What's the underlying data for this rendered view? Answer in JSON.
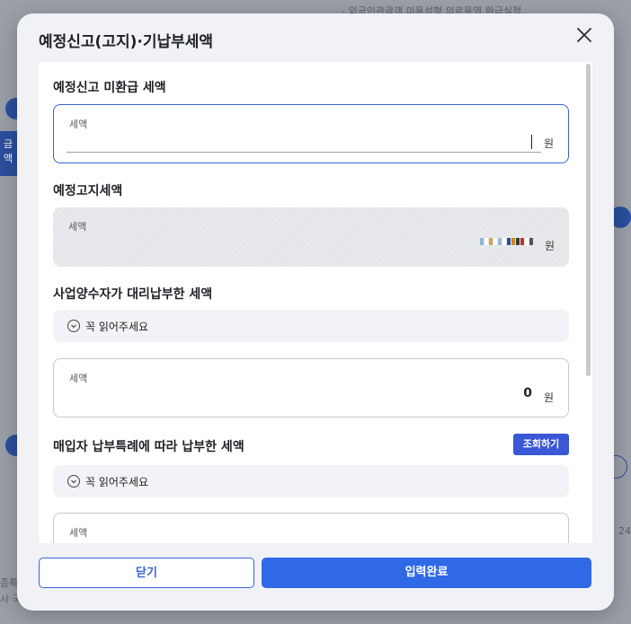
{
  "background": {
    "top_text": "- 외국인관광객 미용성형 의료용역 환급실적...",
    "side_tab": "금액",
    "bottom_left_1": "종특",
    "bottom_left_2": "사 국",
    "bottom_right": "24"
  },
  "modal": {
    "title": "예정신고(고지)·기납부세액",
    "close_icon": "close-icon",
    "sections": [
      {
        "title": "예정신고 미환급 세액",
        "field_label": "세액",
        "value": "",
        "unit": "원"
      },
      {
        "title": "예정고지세액",
        "field_label": "세액",
        "unit": "원"
      },
      {
        "title": "사업양수자가 대리납부한 세액",
        "notice": "꼭 읽어주세요",
        "field_label": "세액",
        "value": "0",
        "unit": "원"
      },
      {
        "title": "매입자 납부특례에 따라 납부한 세액",
        "query_button": "조회하기",
        "notice": "꼭 읽어주세요",
        "field_label": "세액"
      }
    ],
    "footer": {
      "close_label": "닫기",
      "done_label": "입력완료"
    }
  },
  "colors": {
    "primary": "#2f69e6",
    "query_button": "#3a57d6",
    "active_border": "#3b63d8"
  }
}
